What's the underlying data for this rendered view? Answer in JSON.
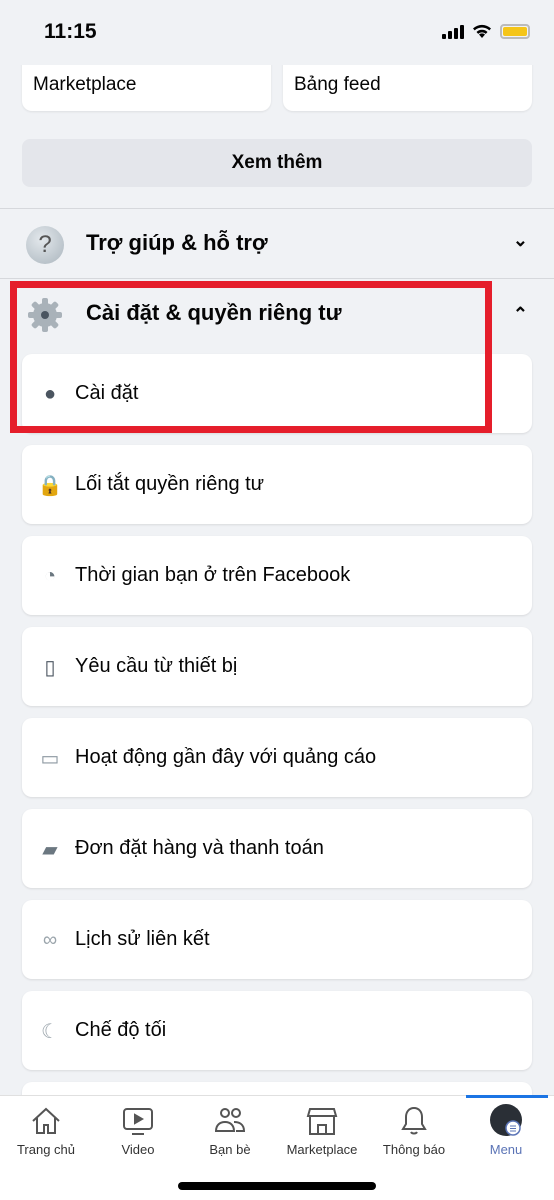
{
  "status_bar": {
    "time": "11:15"
  },
  "top_cards": [
    "Marketplace",
    "Bảng feed"
  ],
  "see_more": "Xem thêm",
  "help": {
    "label": "Trợ giúp & hỗ trợ",
    "icon": "question-icon"
  },
  "settings_section": {
    "label": "Cài đặt & quyền riêng tư",
    "icon": "gear-icon",
    "expanded": true
  },
  "settings_items": [
    {
      "label": "Cài đặt",
      "icon": "person-icon"
    },
    {
      "label": "Lối tắt quyền riêng tư",
      "icon": "lock-icon"
    },
    {
      "label": "Thời gian bạn ở trên Facebook",
      "icon": "clock-icon"
    },
    {
      "label": "Yêu cầu từ thiết bị",
      "icon": "phone-key-icon"
    },
    {
      "label": "Hoạt động gần đây với quảng cáo",
      "icon": "ad-activity-icon"
    },
    {
      "label": "Đơn đặt hàng và thanh toán",
      "icon": "card-icon"
    },
    {
      "label": "Lịch sử liên kết",
      "icon": "link-icon"
    },
    {
      "label": "Chế độ tối",
      "icon": "moon-icon"
    }
  ],
  "highlight_color": "#e51e2b",
  "bottom_nav": [
    {
      "label": "Trang chủ",
      "icon": "home-icon"
    },
    {
      "label": "Video",
      "icon": "video-icon"
    },
    {
      "label": "Bạn bè",
      "icon": "friends-icon"
    },
    {
      "label": "Marketplace",
      "icon": "shop-icon"
    },
    {
      "label": "Thông báo",
      "icon": "bell-icon"
    },
    {
      "label": "Menu",
      "icon": "avatar-menu-icon",
      "active": true
    }
  ]
}
